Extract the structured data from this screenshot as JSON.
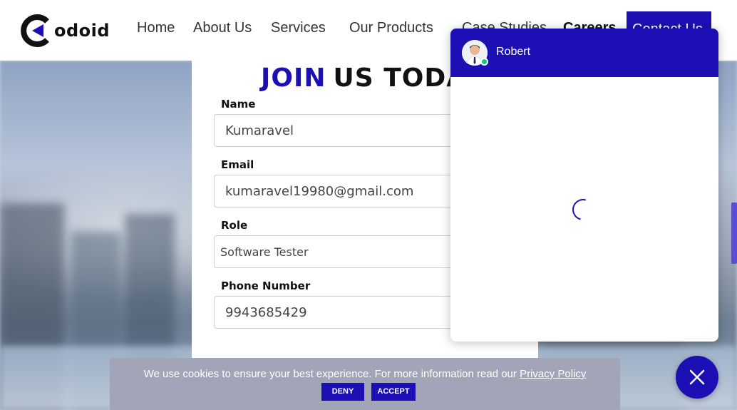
{
  "header": {
    "logo_text": "odoid",
    "nav": [
      {
        "label": "Home",
        "bold": false
      },
      {
        "label": "About Us",
        "bold": false
      },
      {
        "label": "Services",
        "bold": false
      },
      {
        "label": "Our Products",
        "bold": false
      },
      {
        "label": "Case Studies",
        "bold": false
      },
      {
        "label": "Careers",
        "bold": true
      }
    ],
    "contact_label": "Contact Us"
  },
  "form": {
    "title_accent": "JOIN",
    "title_rest": "US TODAY",
    "fields": [
      {
        "label": "Name",
        "value": "Kumaravel"
      },
      {
        "label": "Email",
        "value": "kumaravel19980@gmail.com"
      },
      {
        "label": "Role",
        "value": "Software Tester"
      },
      {
        "label": "Phone Number",
        "value": "9943685429"
      }
    ]
  },
  "chat": {
    "agent_name": "Robert",
    "status": "online"
  },
  "cookie": {
    "message": "We use cookies to ensure your best experience. For more information read our ",
    "link_text": "Privacy Policy",
    "deny_label": "DENY",
    "accept_label": "ACCEPT"
  },
  "colors": {
    "brand": "#1c10b5",
    "online": "#19c37d",
    "cookie_bg": "#a2a4b8"
  },
  "icons": [
    "codoid-logo-icon",
    "agent-avatar-icon",
    "loading-spinner-icon",
    "close-icon"
  ]
}
